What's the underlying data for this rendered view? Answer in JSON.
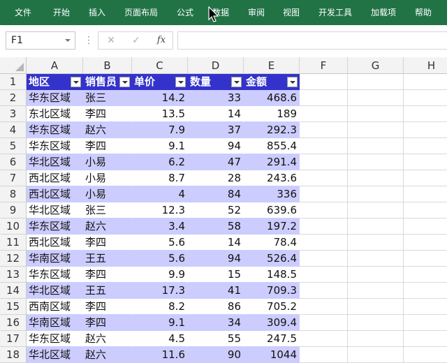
{
  "ribbon": {
    "tabs": [
      "文件",
      "开始",
      "插入",
      "页面布局",
      "公式",
      "数据",
      "审阅",
      "视图",
      "开发工具",
      "加载项",
      "帮助"
    ]
  },
  "formula_bar": {
    "name_box": "F1",
    "cancel_glyph": "✕",
    "enter_glyph": "✓",
    "fx_label": "fx",
    "formula": ""
  },
  "grid": {
    "columns": [
      "A",
      "B",
      "C",
      "D",
      "E",
      "F",
      "G",
      "H"
    ],
    "row_numbers": [
      "1",
      "2",
      "3",
      "4",
      "5",
      "6",
      "7",
      "8",
      "9",
      "10",
      "11",
      "12",
      "13",
      "14",
      "15",
      "16",
      "17",
      "18"
    ],
    "table_headers": [
      "地区",
      "销售员",
      "单价",
      "数量",
      "金额"
    ],
    "rows": [
      [
        "华东区域",
        "张三",
        "14.2",
        "33",
        "468.6"
      ],
      [
        "东北区域",
        "李四",
        "13.5",
        "14",
        "189"
      ],
      [
        "华东区域",
        "赵六",
        "7.9",
        "37",
        "292.3"
      ],
      [
        "华东区域",
        "李四",
        "9.1",
        "94",
        "855.4"
      ],
      [
        "华北区域",
        "小易",
        "6.2",
        "47",
        "291.4"
      ],
      [
        "西北区域",
        "小易",
        "8.7",
        "28",
        "243.6"
      ],
      [
        "西北区域",
        "小易",
        "4",
        "84",
        "336"
      ],
      [
        "华北区域",
        "张三",
        "12.3",
        "52",
        "639.6"
      ],
      [
        "华东区域",
        "赵六",
        "3.4",
        "58",
        "197.2"
      ],
      [
        "西北区域",
        "李四",
        "5.6",
        "14",
        "78.4"
      ],
      [
        "华南区域",
        "王五",
        "5.6",
        "94",
        "526.4"
      ],
      [
        "华东区域",
        "李四",
        "9.9",
        "15",
        "148.5"
      ],
      [
        "华北区域",
        "王五",
        "17.3",
        "41",
        "709.3"
      ],
      [
        "西南区域",
        "李四",
        "8.2",
        "86",
        "705.2"
      ],
      [
        "华南区域",
        "李四",
        "9.1",
        "34",
        "309.4"
      ],
      [
        "华东区域",
        "赵六",
        "4.5",
        "55",
        "247.5"
      ],
      [
        "华北区域",
        "赵六",
        "11.6",
        "90",
        "1044"
      ]
    ]
  },
  "colors": {
    "ribbon": "#217346",
    "table_header": "#3333cc",
    "table_band": "#ccccff"
  }
}
